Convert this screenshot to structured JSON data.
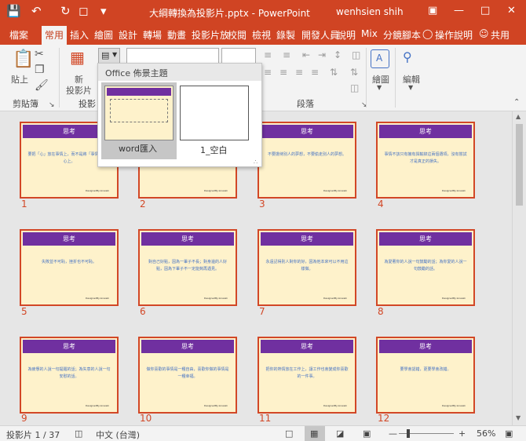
{
  "titlebar": {
    "title": "大綱轉換為投影片.pptx  -  PowerPoint",
    "user": "wenhsien shih"
  },
  "tabs": [
    "檔案",
    "常用",
    "插入",
    "繪圖",
    "設計",
    "轉場",
    "動畫",
    "投影片放",
    "校閱",
    "檢視",
    "錄製",
    "開發人員",
    "說明",
    "Mix",
    "分鏡腳本",
    "操作說明",
    "共用"
  ],
  "ribbon": {
    "clipboard_label": "剪貼簿",
    "paste_label": "貼上",
    "new_slide_label": "新",
    "new_slide_label2": "投影片",
    "slides_group_partial": "投影",
    "paragraph_label": "段落",
    "drawing_label": "繪圖",
    "editing_label": "編輯"
  },
  "popup": {
    "header": "Office 佈景主題",
    "layouts": [
      "word匯入",
      "1_空白"
    ]
  },
  "slide_title": "思考",
  "slide_footer": "DesignedBy:Linweik",
  "slides": [
    {
      "num": "1",
      "text": "要把「心」放在事情上，而不是將「事情」放在心上。"
    },
    {
      "num": "2",
      "text": ""
    },
    {
      "num": "3",
      "text": "不要擔待別人的夢想，不要偷走別人的夢想。"
    },
    {
      "num": "4",
      "text": "事情不該只有擁有與輸掉這兩個選項，沒有嘗試才是真正的損失。"
    },
    {
      "num": "5",
      "text": "失敗並不可恥，挫折也不可恥。"
    },
    {
      "num": "6",
      "text": "對自己好點，因為一輩子不長；對身邊的人好點，因為下輩子不一定能夠再遇見。"
    },
    {
      "num": "7",
      "text": "永遠記得別人對你的好，因為他本來可以不用這樣做。"
    },
    {
      "num": "8",
      "text": "為愛著你的人說一句鼓勵的話；為你愛的人說一句鼓勵的話。"
    },
    {
      "num": "9",
      "text": "為疲憊的人說一句提醒的話；為失意的人說一句安慰的話。"
    },
    {
      "num": "10",
      "text": "做你喜歡的事情是一種自由，喜歡你做的事情是一種幸福。"
    },
    {
      "num": "11",
      "text": "把你的熱情放在工作上，讓工作也會變成你喜歡的一件事。"
    },
    {
      "num": "12",
      "text": "要學會認錯，更要學會改錯。"
    }
  ],
  "status": {
    "slide_count": "投影片 1 / 37",
    "language": "中文 (台灣)",
    "zoom": "56%"
  }
}
